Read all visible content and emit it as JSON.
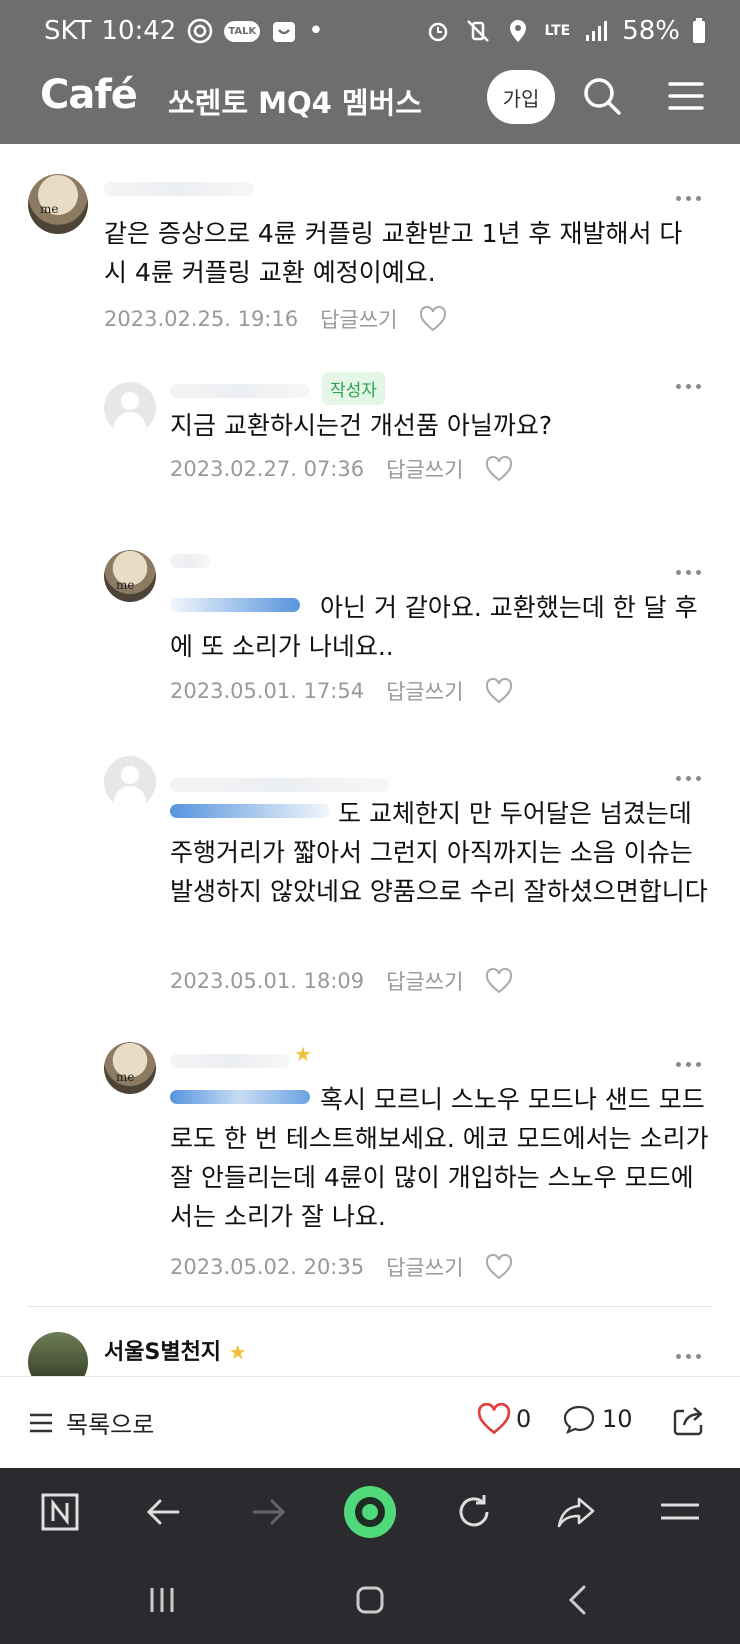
{
  "status_bar": {
    "carrier": "SKT",
    "time": "10:42",
    "talk_badge": "TALK",
    "dot": "•",
    "network": "LTE",
    "battery": "58%"
  },
  "header": {
    "logo": "Café",
    "cafe_name": "쏘렌토 MQ4 멤버스",
    "join_label": "가입"
  },
  "comments": [
    {
      "text": "같은 증상으로 4륜 커플링 교환받고 1년 후 재발해서 다시 4륜 커플링 교환 예정이예요.",
      "date": "2023.02.25. 19:16",
      "reply": "답글쓰기"
    },
    {
      "badge": "작성자",
      "text": "지금 교환하시는건 개선품 아닐까요?",
      "date": "2023.02.27. 07:36",
      "reply": "답글쓰기"
    },
    {
      "text": "아닌 거 같아요. 교환했는데 한 달 후에 또 소리가 나네요..",
      "date": "2023.05.01. 17:54",
      "reply": "답글쓰기"
    },
    {
      "text": "도 교체한지 만 두어달은 넘겼는데 주행거리가 짧아서 그런지 아직까지는 소음 이슈는 발생하지 않았네요 양품으로 수리 잘하셨으면합니다",
      "date": "2023.05.01. 18:09",
      "reply": "답글쓰기"
    },
    {
      "text": "혹시 모르니 스노우 모드나 샌드 모드로도 한 번 테스트해보세요. 에코 모드에서는 소리가 잘 안들리는데 4륜이 많이 개입하는 스노우 모드에서는 소리가 잘 나요.",
      "date": "2023.05.02. 20:35",
      "reply": "답글쓰기"
    },
    {
      "name": "서울S별천지",
      "star": "★"
    }
  ],
  "action_bar": {
    "list_label": "목록으로",
    "like_count": "0",
    "comment_count": "10"
  },
  "colors": {
    "header_bg": "#6e6e6e",
    "mention": "#2c7ad6",
    "author_badge": "#29a34a",
    "like_heart": "#e04040",
    "nav_bg": "#2b2b2f",
    "home_green": "#4fd97a"
  }
}
